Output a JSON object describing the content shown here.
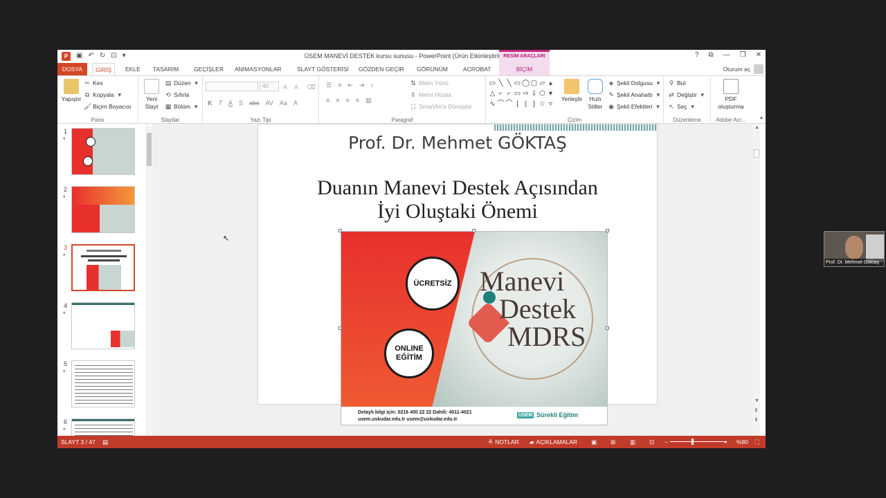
{
  "window": {
    "title": "ÜSEM MANEVİ DESTEK kursu sunusu - PowerPoint (Ürün Etkinleştirilemedi)",
    "contextual_tab_header": "RESİM ARAÇLARI",
    "controls": [
      "?",
      "⧉",
      "—",
      "❐",
      "✕"
    ]
  },
  "tabs": {
    "file": "DOSYA",
    "items": [
      "GİRİŞ",
      "EKLE",
      "TASARIM",
      "GEÇİŞLER",
      "ANİMASYONLAR",
      "SLAYT GÖSTERİSİ",
      "GÖZDEN GEÇİR",
      "GÖRÜNÜM",
      "ACROBAT"
    ],
    "contextual": "BİÇİM",
    "sign_in": "Oturum aç"
  },
  "ribbon": {
    "clipboard": {
      "paste": "Yapıştır",
      "cut": "Kes",
      "copy": "Kopyala",
      "format_painter": "Biçim Boyacısı",
      "label": "Pano"
    },
    "slides": {
      "new_slide_1": "Yeni",
      "new_slide_2": "Slayt",
      "layout": "Düzen",
      "reset": "Sıfırla",
      "section": "Bölüm",
      "label": "Slaytlar"
    },
    "font": {
      "size": "40",
      "label": "Yazı Tipi"
    },
    "paragraph": {
      "text_direction": "Metin Yönü",
      "align_text": "Metni Hizala",
      "smartart": "SmartArt'a Dönüştür",
      "label": "Paragraf"
    },
    "drawing": {
      "arrange": "Yerleştir",
      "quick_styles_1": "Hızlı",
      "quick_styles_2": "Stiller",
      "shape_fill": "Şekil Dolgusu",
      "shape_outline": "Şekil Anahattı",
      "shape_effects": "Şekil Efektleri",
      "label": "Çizim"
    },
    "editing": {
      "find": "Bul",
      "replace": "Değiştir",
      "select": "Seç",
      "label": "Düzenleme"
    },
    "acrobat": {
      "pdf_1": "PDF",
      "pdf_2": "oluşturma",
      "label": "Adobe Acr..."
    }
  },
  "thumbnails": [
    {
      "num": "1",
      "star": "*"
    },
    {
      "num": "2",
      "star": "*"
    },
    {
      "num": "3",
      "star": "*"
    },
    {
      "num": "4",
      "star": "*"
    },
    {
      "num": "5",
      "star": "*"
    },
    {
      "num": "6",
      "star": "*"
    }
  ],
  "slide": {
    "author": "Prof. Dr. Mehmet GÖKTAŞ",
    "title_line1": "Duanın Manevi Destek Açısından",
    "title_line2": "İyi Oluştaki Önemi",
    "poster": {
      "badge1": "ÜCRETSİZ",
      "badge2_line1": "ONLINE",
      "badge2_line2": "EĞİTİM",
      "logo_line1": "Manevi",
      "logo_line2": "Destek",
      "logo_line3": "MDRS",
      "footer_info": "Detaylı bilgi için: 0216 400 22 22   Dahili: 4011-4021",
      "footer_web": "usem.uskudar.edu.tr      usem@uskudar.edu.tr",
      "footer_brand": "ÜSEM",
      "footer_brand_tag": "Sürekli Eğitim"
    }
  },
  "statusbar": {
    "slide_info": "SLAYT 3 / 47",
    "notes": "NOTLAR",
    "comments": "AÇIKLAMALAR",
    "zoom": "%80"
  },
  "video": {
    "name": "Prof. Dr. Mehmet Göktaş"
  },
  "colors": {
    "accent": "#d24726",
    "status": "#c13b2a",
    "contextual": "#b0237a"
  }
}
